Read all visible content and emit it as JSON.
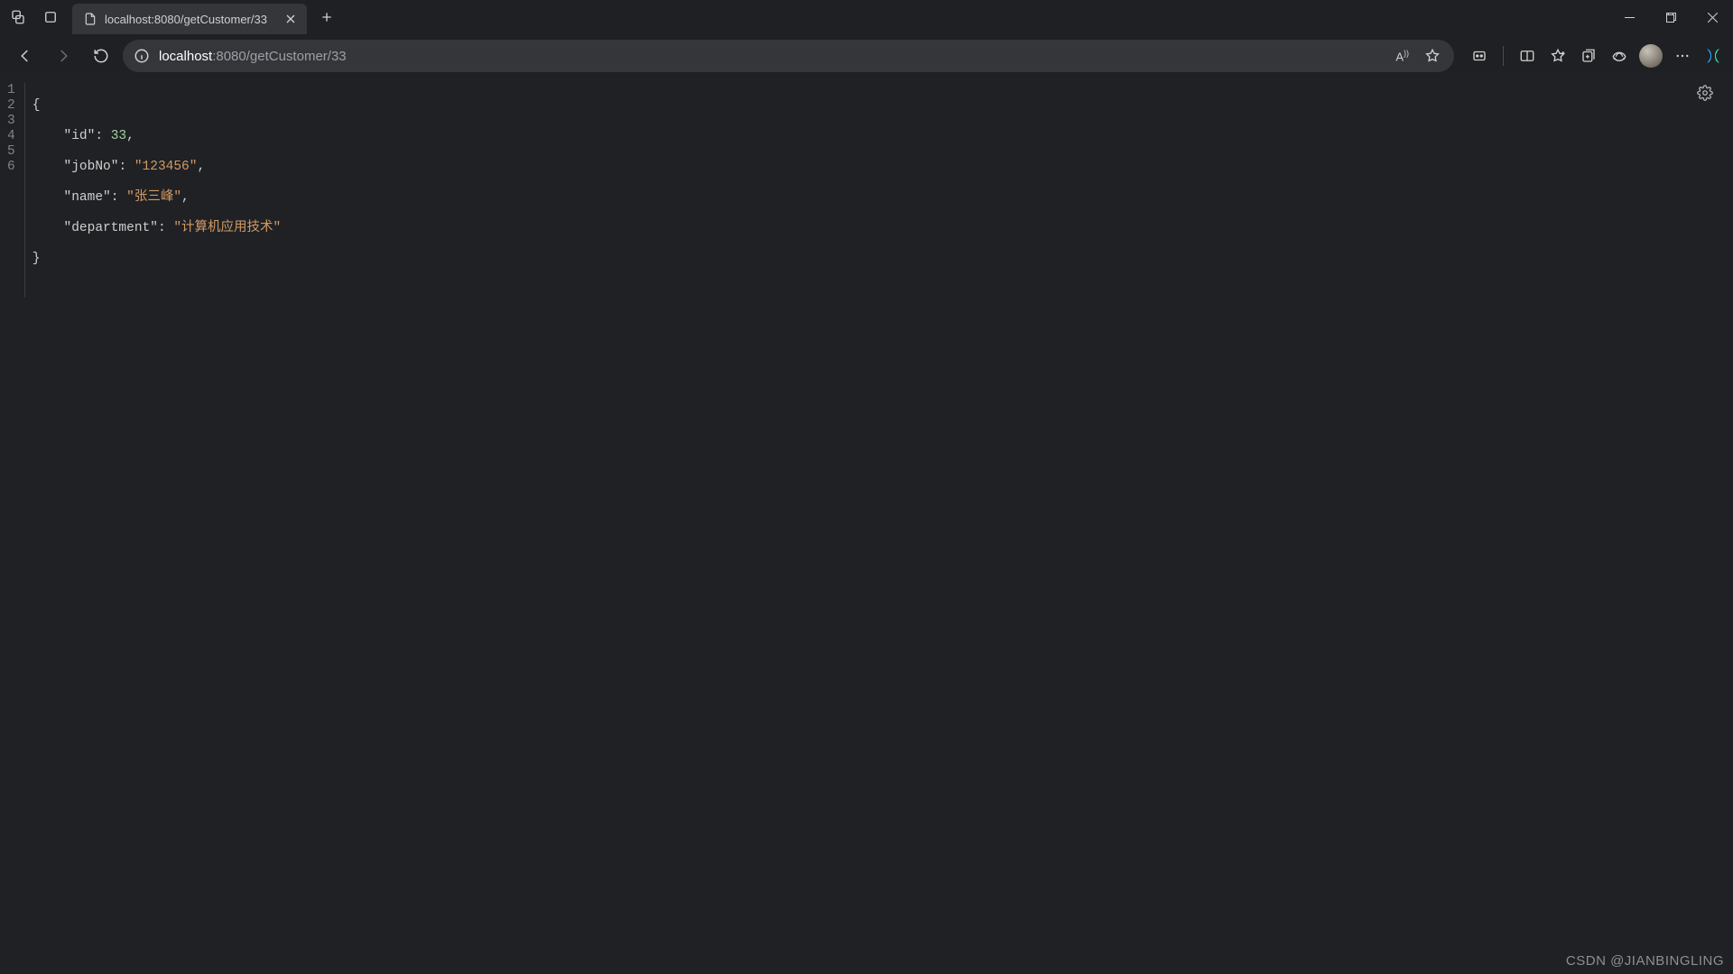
{
  "tab": {
    "title": "localhost:8080/getCustomer/33"
  },
  "url": {
    "host": "localhost",
    "rest": ":8080/getCustomer/33"
  },
  "line_numbers": [
    "1",
    "2",
    "3",
    "4",
    "5",
    "6"
  ],
  "json_response": {
    "id_key": "id",
    "id_value": "33",
    "jobNo_key": "jobNo",
    "jobNo_value": "123456",
    "name_key": "name",
    "name_value": "张三峰",
    "department_key": "department",
    "department_value": "计算机应用技术"
  },
  "read_aloud_label": "A))",
  "watermark": "CSDN @JIANBINGLING"
}
